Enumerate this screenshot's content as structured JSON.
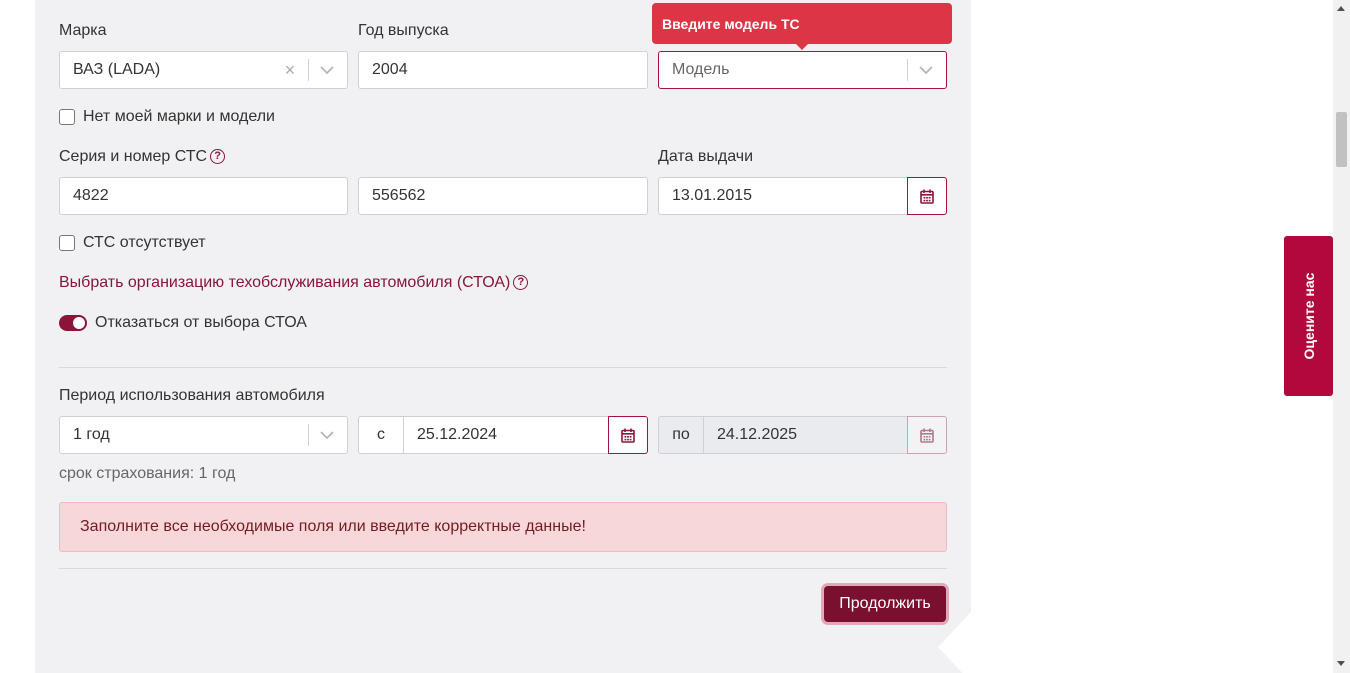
{
  "brand": {
    "label": "Марка",
    "value": "ВАЗ (LADA)"
  },
  "year": {
    "label": "Год выпуска",
    "value": "2004"
  },
  "model": {
    "placeholder": "Модель",
    "tooltip": "Введите модель ТС"
  },
  "no_brand_checkbox": {
    "label": "Нет моей марки и модели"
  },
  "sts": {
    "label": "Серия и номер СТС",
    "series": "4822",
    "number": "556562"
  },
  "issue_date": {
    "label": "Дата выдачи",
    "value": "13.01.2015"
  },
  "no_sts_checkbox": {
    "label": "СТС отсутствует"
  },
  "stoa": {
    "link": "Выбрать организацию техобслуживания автомобиля (СТОА)",
    "toggle_label": "Отказаться от выбора СТОА"
  },
  "period": {
    "label": "Период использования автомобиля",
    "value": "1 год",
    "from_prefix": "с",
    "from_date": "25.12.2024",
    "to_prefix": "по",
    "to_date": "24.12.2025",
    "term_text": "срок страхования: 1 год"
  },
  "alert": {
    "text": "Заполните все необходимые поля или введите корректные данные!"
  },
  "continue_button": "Продолжить",
  "feedback_tab": "Оцените нас",
  "help_glyph": "?",
  "colors": {
    "accent": "#8a1538",
    "button": "#7a0f30",
    "tooltip": "#dc3545",
    "alert_bg": "#f8d7da",
    "feedback_tab": "#b3083d"
  }
}
